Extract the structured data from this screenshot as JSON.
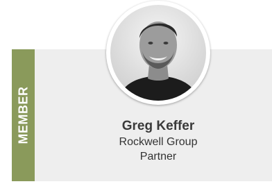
{
  "member_card": {
    "badge_label": "MEMBER",
    "name": "Greg Keffer",
    "company": "Rockwell Group",
    "role": "Partner"
  },
  "colors": {
    "badge": "#8a9a5b",
    "card_background": "#eeeeee"
  },
  "icons": {
    "avatar": "profile-photo"
  }
}
